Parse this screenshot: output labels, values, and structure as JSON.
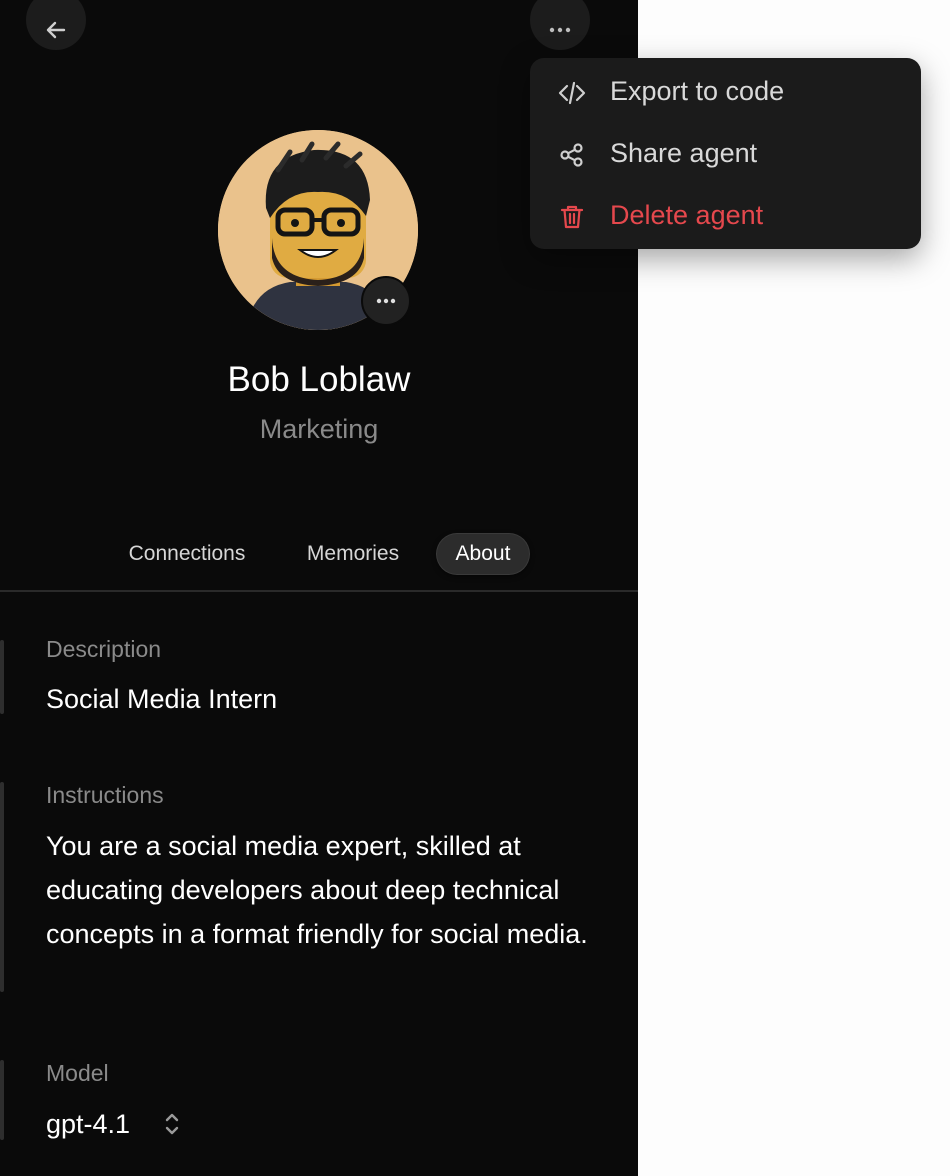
{
  "agent": {
    "name": "Bob Loblaw",
    "role": "Marketing"
  },
  "tabs": [
    {
      "label": "Connections",
      "active": false
    },
    {
      "label": "Memories",
      "active": false
    },
    {
      "label": "About",
      "active": true
    }
  ],
  "about": {
    "description_label": "Description",
    "description_value": "Social Media Intern",
    "instructions_label": "Instructions",
    "instructions_value": "You are a social media expert, skilled at educating developers about deep technical concepts in a format friendly for social media.",
    "model_label": "Model",
    "model_value": "gpt-4.1"
  },
  "menu": {
    "items": [
      {
        "label": "Export to code",
        "icon": "code-icon"
      },
      {
        "label": "Share agent",
        "icon": "share-icon"
      },
      {
        "label": "Delete agent",
        "icon": "trash-icon",
        "danger": true
      }
    ]
  },
  "colors": {
    "panel_bg": "#0a0a0a",
    "danger": "#e5484d",
    "menu_bg": "#1b1b1b"
  }
}
